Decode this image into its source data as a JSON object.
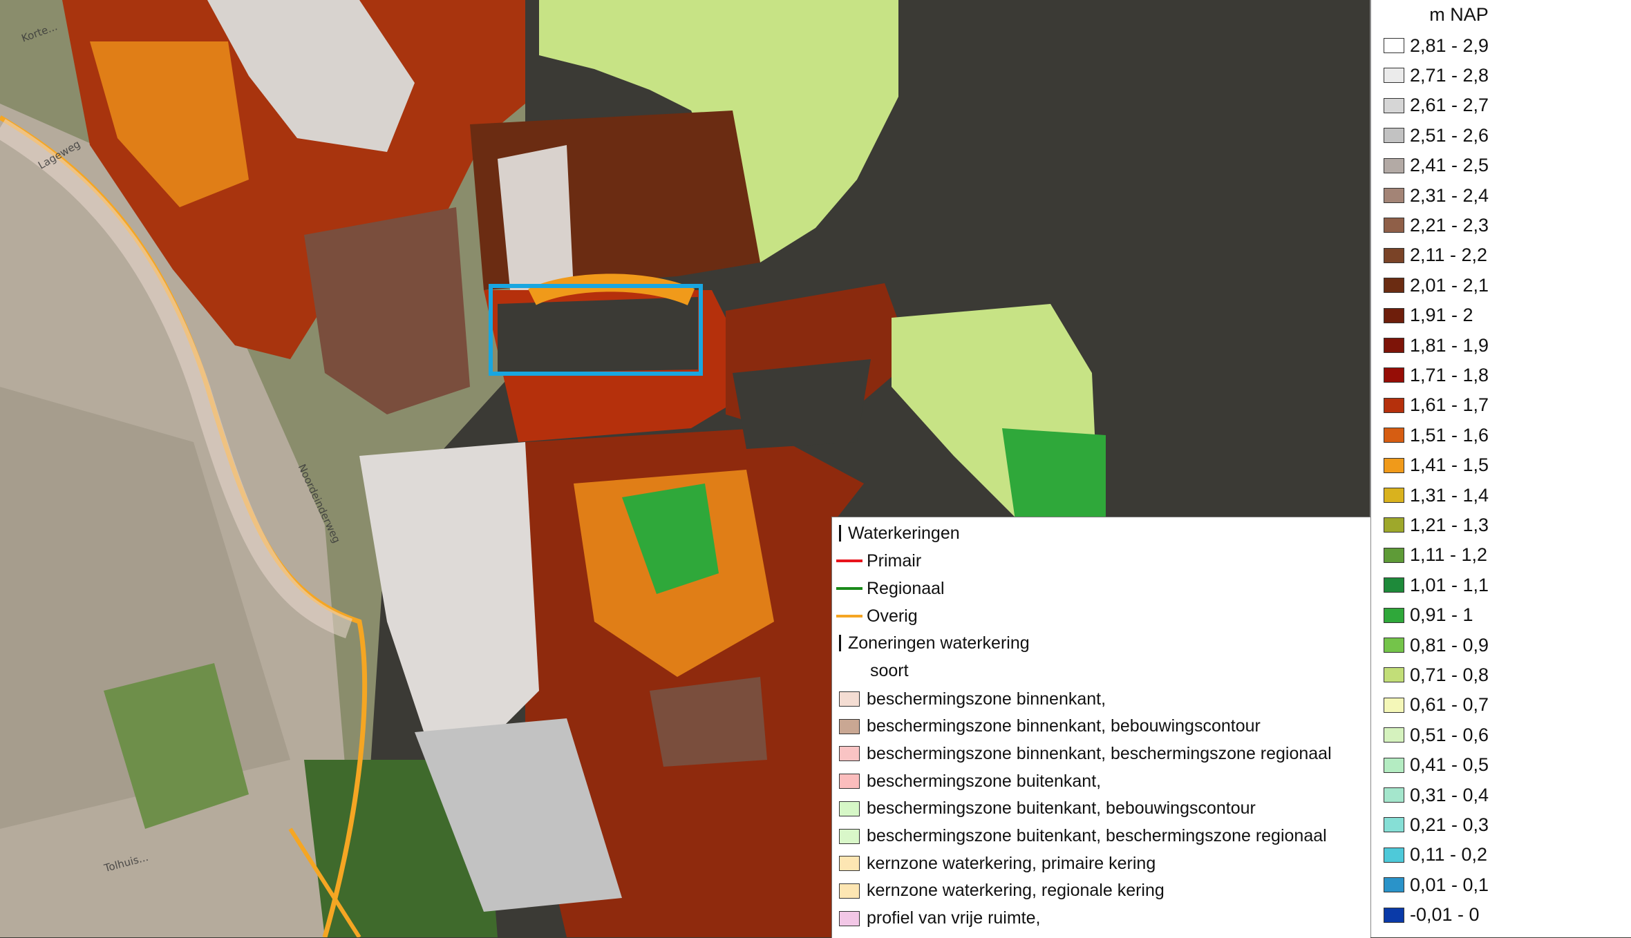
{
  "map": {
    "road_labels": [
      "Korte...",
      "Lageweg",
      "Noordeinderweg",
      "Tolhuis..."
    ]
  },
  "elevation_legend": {
    "title": "m NAP",
    "classes": [
      {
        "label": "2,81 - 2,9",
        "color": "#ffffff"
      },
      {
        "label": "2,71 - 2,8",
        "color": "#ebebeb"
      },
      {
        "label": "2,61 - 2,7",
        "color": "#d6d6d6"
      },
      {
        "label": "2,51 - 2,6",
        "color": "#c2c2c2"
      },
      {
        "label": "2,41 - 2,5",
        "color": "#b3aaa5"
      },
      {
        "label": "2,31 - 2,4",
        "color": "#a38476"
      },
      {
        "label": "2,21 - 2,3",
        "color": "#8f5f48"
      },
      {
        "label": "2,11 - 2,2",
        "color": "#7a4327"
      },
      {
        "label": "2,01 - 2,1",
        "color": "#6b2c12"
      },
      {
        "label": "1,91 - 2",
        "color": "#6e1e0b"
      },
      {
        "label": "1,81 - 1,9",
        "color": "#7d1408"
      },
      {
        "label": "1,71 - 1,8",
        "color": "#960d06"
      },
      {
        "label": "1,61 - 1,7",
        "color": "#b5300c"
      },
      {
        "label": "1,51 - 1,6",
        "color": "#d65d12"
      },
      {
        "label": "1,41 - 1,5",
        "color": "#f09a1a"
      },
      {
        "label": "1,31 - 1,4",
        "color": "#d9b21e"
      },
      {
        "label": "1,21 - 1,3",
        "color": "#9ea82b"
      },
      {
        "label": "1,11 - 1,2",
        "color": "#5e9b37"
      },
      {
        "label": "1,01 - 1,1",
        "color": "#1e8a3a"
      },
      {
        "label": "0,91 - 1",
        "color": "#2fa83a"
      },
      {
        "label": "0,81 - 0,9",
        "color": "#74c44a"
      },
      {
        "label": "0,71 - 0,8",
        "color": "#c2de78"
      },
      {
        "label": "0,61 - 0,7",
        "color": "#f4f7b8"
      },
      {
        "label": "0,51 - 0,6",
        "color": "#d5f2be"
      },
      {
        "label": "0,41 - 0,5",
        "color": "#b4ecc2"
      },
      {
        "label": "0,31 - 0,4",
        "color": "#a4e6cc"
      },
      {
        "label": "0,21 - 0,3",
        "color": "#86dfd6"
      },
      {
        "label": "0,11 - 0,2",
        "color": "#4ec9d9"
      },
      {
        "label": "0,01 - 0,1",
        "color": "#2a93c9"
      },
      {
        "label": "-0,01 - 0",
        "color": "#0a3aa8"
      }
    ]
  },
  "zone_legend": {
    "waterkeringen_heading": "Waterkeringen",
    "lines": [
      {
        "label": "Primair",
        "color": "#e8141c"
      },
      {
        "label": "Regionaal",
        "color": "#1a8a1a"
      },
      {
        "label": "Overig",
        "color": "#f5a623"
      }
    ],
    "zoneringen_heading": "Zoneringen waterkering",
    "soort_label": "soort",
    "zones": [
      {
        "label": "beschermingszone binnenkant,",
        "color": "#f4ddd3"
      },
      {
        "label": "beschermingszone binnenkant, bebouwingscontour",
        "color": "#c9a793"
      },
      {
        "label": "beschermingszone binnenkant, beschermingszone regionaal",
        "color": "#f9c4c4"
      },
      {
        "label": "beschermingszone buitenkant,",
        "color": "#fbbdbd"
      },
      {
        "label": "beschermingszone buitenkant, bebouwingscontour",
        "color": "#d6f7c7"
      },
      {
        "label": "beschermingszone buitenkant, beschermingszone regionaal",
        "color": "#d9f7c9"
      },
      {
        "label": "kernzone waterkering, primaire kering",
        "color": "#fde6b3"
      },
      {
        "label": "kernzone waterkering, regionale kering",
        "color": "#fde6b3"
      },
      {
        "label": "profiel  van vrije ruimte,",
        "color": "#f2c7e6"
      }
    ]
  }
}
